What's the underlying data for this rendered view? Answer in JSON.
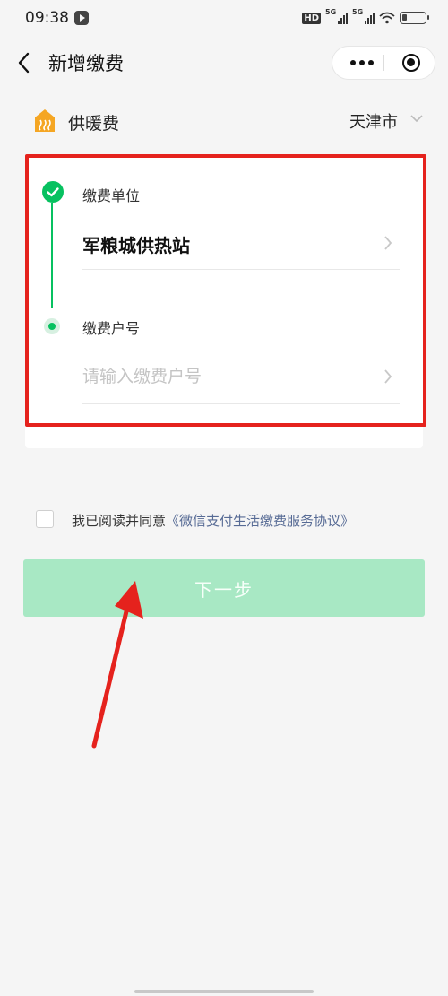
{
  "status_bar": {
    "time": "09:38",
    "hd": "HD",
    "net1": "5G",
    "net2": "5G"
  },
  "nav": {
    "title": "新增缴费"
  },
  "category": {
    "label": "供暖费",
    "city": "天津市"
  },
  "form": {
    "step1_label": "缴费单位",
    "unit_value": "军粮城供热站",
    "step2_label": "缴费户号",
    "account_placeholder": "请输入缴费户号",
    "account_value": ""
  },
  "agreement": {
    "prefix": "我已阅读并同意",
    "link": "《微信支付生活缴费服务协议》",
    "checked": false
  },
  "next_button": {
    "label": "下一步",
    "enabled": false
  },
  "colors": {
    "accent": "#07c160",
    "highlight_border": "#e5221d",
    "link": "#576b95",
    "button_disabled": "#a8e8c4"
  }
}
